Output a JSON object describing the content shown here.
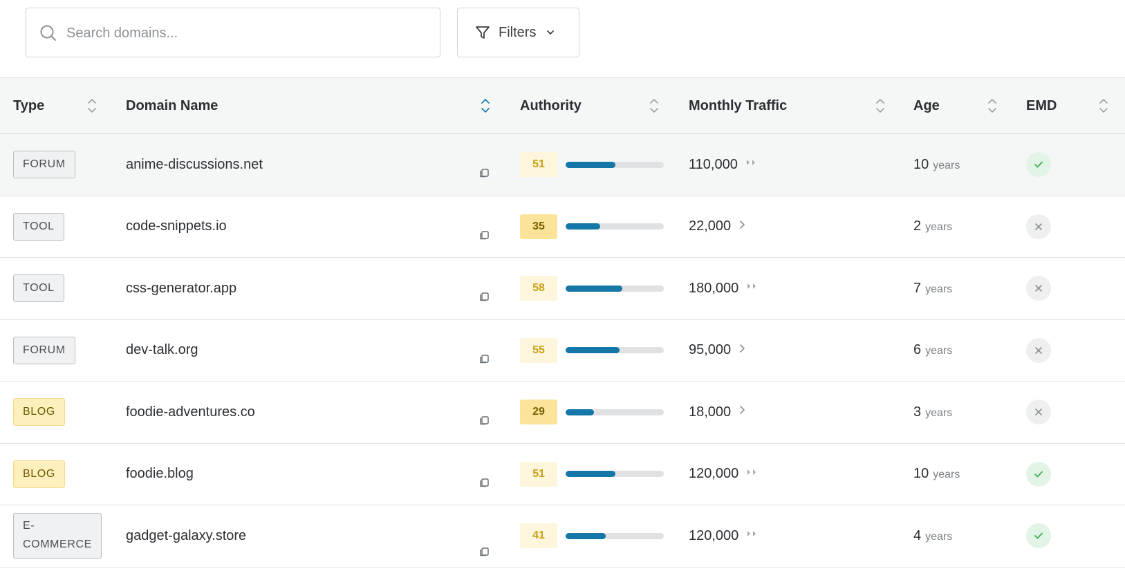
{
  "search": {
    "placeholder": "Search domains..."
  },
  "filters": {
    "label": "Filters"
  },
  "columns": [
    {
      "key": "type",
      "label": "Type"
    },
    {
      "key": "domain",
      "label": "Domain Name"
    },
    {
      "key": "authority",
      "label": "Authority"
    },
    {
      "key": "traffic",
      "label": "Monthly Traffic"
    },
    {
      "key": "age",
      "label": "Age"
    },
    {
      "key": "emd",
      "label": "EMD"
    }
  ],
  "active_sort": "domain",
  "rows": [
    {
      "type": "FORUM",
      "type_style": "gray",
      "domain": "anime-discussions.net",
      "authority": 51,
      "authority_fill": 0.51,
      "traffic": "110,000",
      "trend": "double",
      "age_num": "10",
      "age_unit": "years",
      "emd": true,
      "highlighted": true
    },
    {
      "type": "TOOL",
      "type_style": "gray",
      "domain": "code-snippets.io",
      "authority": 35,
      "authority_fill": 0.35,
      "traffic": "22,000",
      "trend": "single",
      "age_num": "2",
      "age_unit": "years",
      "emd": false,
      "highlighted": false
    },
    {
      "type": "TOOL",
      "type_style": "gray",
      "domain": "css-generator.app",
      "authority": 58,
      "authority_fill": 0.58,
      "traffic": "180,000",
      "trend": "double",
      "age_num": "7",
      "age_unit": "years",
      "emd": false,
      "highlighted": false
    },
    {
      "type": "FORUM",
      "type_style": "gray",
      "domain": "dev-talk.org",
      "authority": 55,
      "authority_fill": 0.55,
      "traffic": "95,000",
      "trend": "single",
      "age_num": "6",
      "age_unit": "years",
      "emd": false,
      "highlighted": false
    },
    {
      "type": "BLOG",
      "type_style": "yellow",
      "domain": "foodie-adventures.co",
      "authority": 29,
      "authority_fill": 0.29,
      "traffic": "18,000",
      "trend": "single",
      "age_num": "3",
      "age_unit": "years",
      "emd": false,
      "highlighted": false
    },
    {
      "type": "BLOG",
      "type_style": "yellow",
      "domain": "foodie.blog",
      "authority": 51,
      "authority_fill": 0.51,
      "traffic": "120,000",
      "trend": "double",
      "age_num": "10",
      "age_unit": "years",
      "emd": true,
      "highlighted": false
    },
    {
      "type": "E-COMMERCE",
      "type_lines": [
        "E-",
        "COMMERCE"
      ],
      "type_style": "gray",
      "domain": "gadget-galaxy.store",
      "authority": 41,
      "authority_fill": 0.41,
      "traffic": "120,000",
      "trend": "double",
      "age_num": "4",
      "age_unit": "years",
      "emd": true,
      "highlighted": false
    }
  ],
  "colors": {
    "accent": "#1576a8",
    "emd_yes": "#3cae54",
    "emd_no": "#8a9095"
  },
  "icons": {
    "search": "search-icon",
    "filter": "filter-icon",
    "copy": "copy-icon",
    "sort": "sort-icon",
    "check": "check-icon",
    "cross": "close-icon"
  }
}
